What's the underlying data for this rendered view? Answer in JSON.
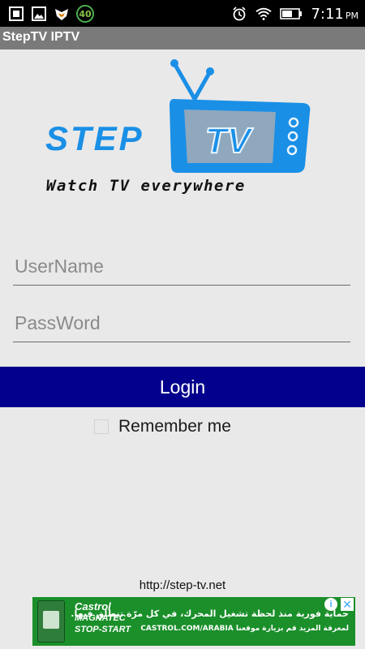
{
  "status_bar": {
    "time": "7:11",
    "ampm": "PM",
    "notification_badge": "40",
    "icons": [
      "gallery-icon",
      "image-icon",
      "fox-app-icon",
      "alarm-icon",
      "wifi-icon",
      "battery-icon"
    ]
  },
  "app_bar": {
    "title": "StepTV IPTV"
  },
  "logo": {
    "step_text": "STEP",
    "tv_text": "TV",
    "tagline": "Watch TV everywhere",
    "colors": {
      "blue": "#1a8fe6",
      "screen": "#8fa8bd",
      "dark": "#111111"
    }
  },
  "form": {
    "username_placeholder": "UserName",
    "password_placeholder": "PassWord",
    "login_label": "Login",
    "remember_label": "Remember me",
    "remember_checked": false
  },
  "footer": {
    "url": "http://step-tv.net"
  },
  "ad": {
    "brand": "Castrol",
    "product": "MAGNATEC",
    "variant": "STOP-START",
    "headline": "حماية فورية منذ لحظة تشغيل المحرك، في كل مرّة تنطلق فيها.",
    "subline": "لمعرفة المزيد قم بزيارة موقعنا CASTROL.COM/ARABIA"
  },
  "colors": {
    "login_button": "#02008c",
    "background": "#e9e9e9",
    "app_bar": "#7a7a7a"
  }
}
